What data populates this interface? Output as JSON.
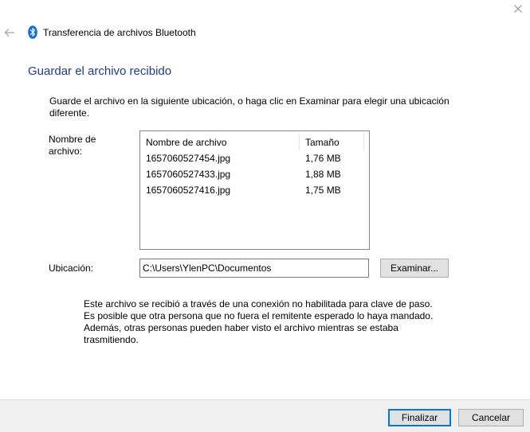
{
  "window": {
    "title": "Transferencia de archivos Bluetooth",
    "close_icon": "close-icon",
    "back_icon": "back-arrow-icon",
    "app_icon": "bluetooth-icon"
  },
  "page": {
    "title": "Guardar el archivo recibido",
    "instructions": "Guarde el archivo en la siguiente ubicación, o haga clic en Examinar para elegir una ubicación diferente."
  },
  "files": {
    "label": "Nombre de archivo:",
    "columns": {
      "name": "Nombre de archivo",
      "size": "Tamaño"
    },
    "rows": [
      {
        "name": "1657060527454.jpg",
        "size": "1,76 MB"
      },
      {
        "name": "1657060527433.jpg",
        "size": "1,88 MB"
      },
      {
        "name": "1657060527416.jpg",
        "size": "1,75 MB"
      }
    ]
  },
  "location": {
    "label": "Ubicación:",
    "value": "C:\\Users\\YlenPC\\Documentos",
    "browse_label": "Examinar..."
  },
  "note": "Este archivo se recibió a través de una conexión no habilitada para clave de paso. Es posible que otra persona que no fuera el remitente esperado lo haya mandado. Además, otras personas pueden haber visto el archivo mientras se estaba trasmitiendo.",
  "footer": {
    "finish_label": "Finalizar",
    "cancel_label": "Cancelar"
  },
  "colors": {
    "title_blue": "#1e3c8c",
    "accent": "#0078d7",
    "bluetooth": "#0a6fd6"
  }
}
